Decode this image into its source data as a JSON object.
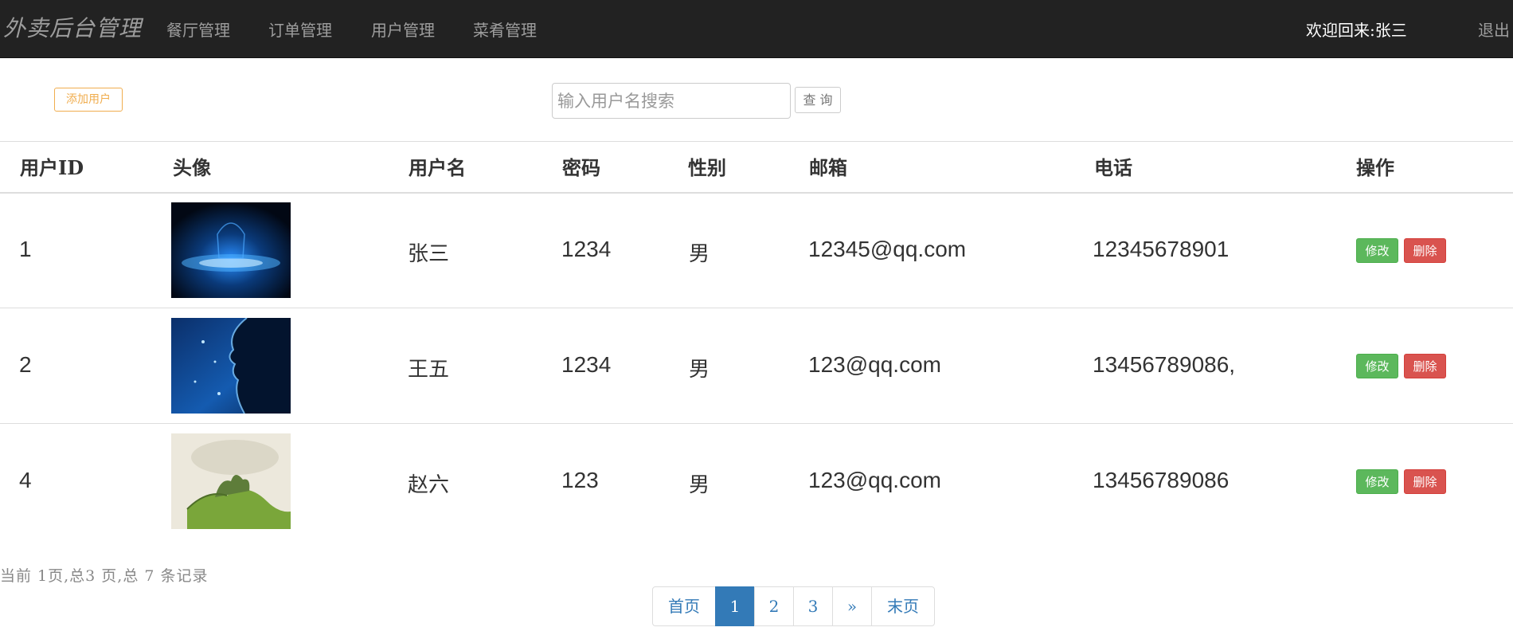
{
  "nav": {
    "brand": "外卖后台管理",
    "items": [
      "餐厅管理",
      "订单管理",
      "用户管理",
      "菜肴管理"
    ],
    "welcome": "欢迎回来:张三",
    "logout": "退出"
  },
  "toolbar": {
    "add_label": "添加用户",
    "search_placeholder": "输入用户名搜索",
    "search_label": "查 询"
  },
  "table": {
    "headers": [
      "用户ID",
      "头像",
      "用户名",
      "密码",
      "性别",
      "邮箱",
      "电话",
      "操作"
    ],
    "rows": [
      {
        "id": "1",
        "name": "张三",
        "password": "1234",
        "gender": "男",
        "email": "12345@qq.com",
        "phone": "12345678901",
        "avatar": "blue-particle-hand-image"
      },
      {
        "id": "2",
        "name": "王五",
        "password": "1234",
        "gender": "男",
        "email": "123@qq.com",
        "phone": "13456789086,",
        "avatar": "blue-particle-face-image"
      },
      {
        "id": "4",
        "name": "赵六",
        "password": "123",
        "gender": "男",
        "email": "123@qq.com",
        "phone": "13456789086",
        "avatar": "landscape-painting-image"
      }
    ],
    "edit_label": "修改",
    "delete_label": "删除"
  },
  "pagination": {
    "summary": "当前 1页,总3 页,总 7 条记录",
    "first": "首页",
    "pages": [
      "1",
      "2",
      "3"
    ],
    "next": "»",
    "last": "末页",
    "current": "1"
  },
  "colors": {
    "navbar": "#222222",
    "accent": "#337ab7",
    "edit": "#5cb85c",
    "delete": "#d9534f",
    "add": "#f0ad4e"
  }
}
